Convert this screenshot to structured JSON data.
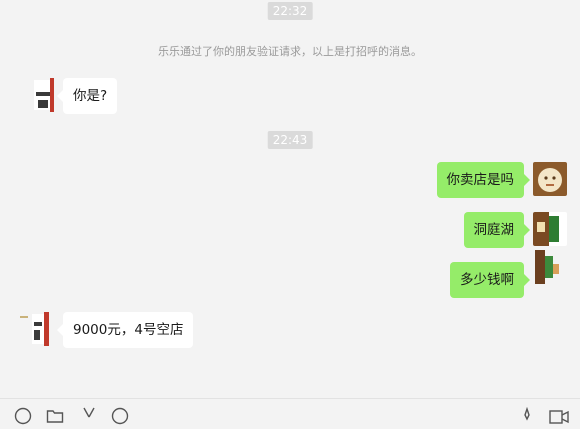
{
  "chat": {
    "time_1": "22:32",
    "system_notice": "乐乐通过了你的朋友验证请求，以上是打招呼的消息。",
    "msg_1": "你是?",
    "time_2": "22:43",
    "msg_2": "你卖店是吗",
    "msg_3": "洞庭湖",
    "msg_4": "多少钱啊",
    "msg_5": "9000元，4号空店"
  },
  "colors": {
    "background": "#f3f3f3",
    "self_bubble": "#95ec69",
    "other_bubble": "#ffffff",
    "time_pill": "#dadada"
  },
  "toolbar": {
    "icons": [
      "emoji-icon",
      "folder-icon",
      "scissors-icon",
      "chat-history-icon",
      "voice-call-icon",
      "video-call-icon"
    ]
  }
}
